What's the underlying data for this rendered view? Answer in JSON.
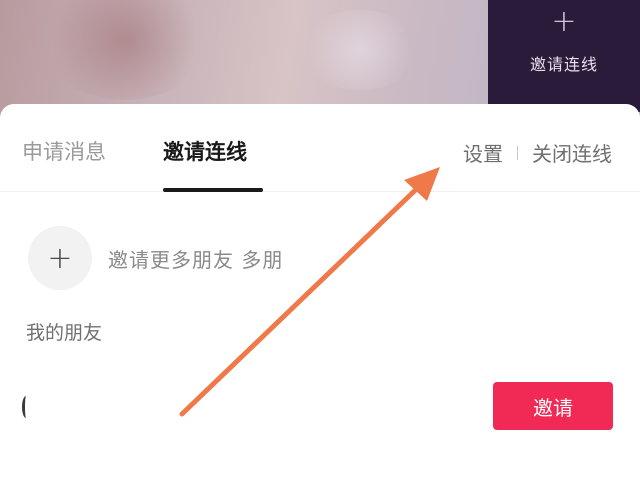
{
  "top_tile": {
    "plus_icon": "+",
    "label": "邀请连线"
  },
  "tabs": [
    {
      "label": "申请消息",
      "active": false
    },
    {
      "label": "邀请连线",
      "active": true
    }
  ],
  "actions": {
    "settings": "设置",
    "close_connection": "关闭连线"
  },
  "invite_more": {
    "plus_icon": "+",
    "label": "邀请更多朋友 多朋"
  },
  "section_title": "我的朋友",
  "friend_row": {
    "invite_button": "邀请"
  },
  "colors": {
    "tile_bg": "#2b1b3a",
    "invite_button": "#f02a54",
    "annotation_arrow": "#f0794a"
  },
  "annotation": {
    "type": "arrow",
    "points_to": "settings"
  }
}
